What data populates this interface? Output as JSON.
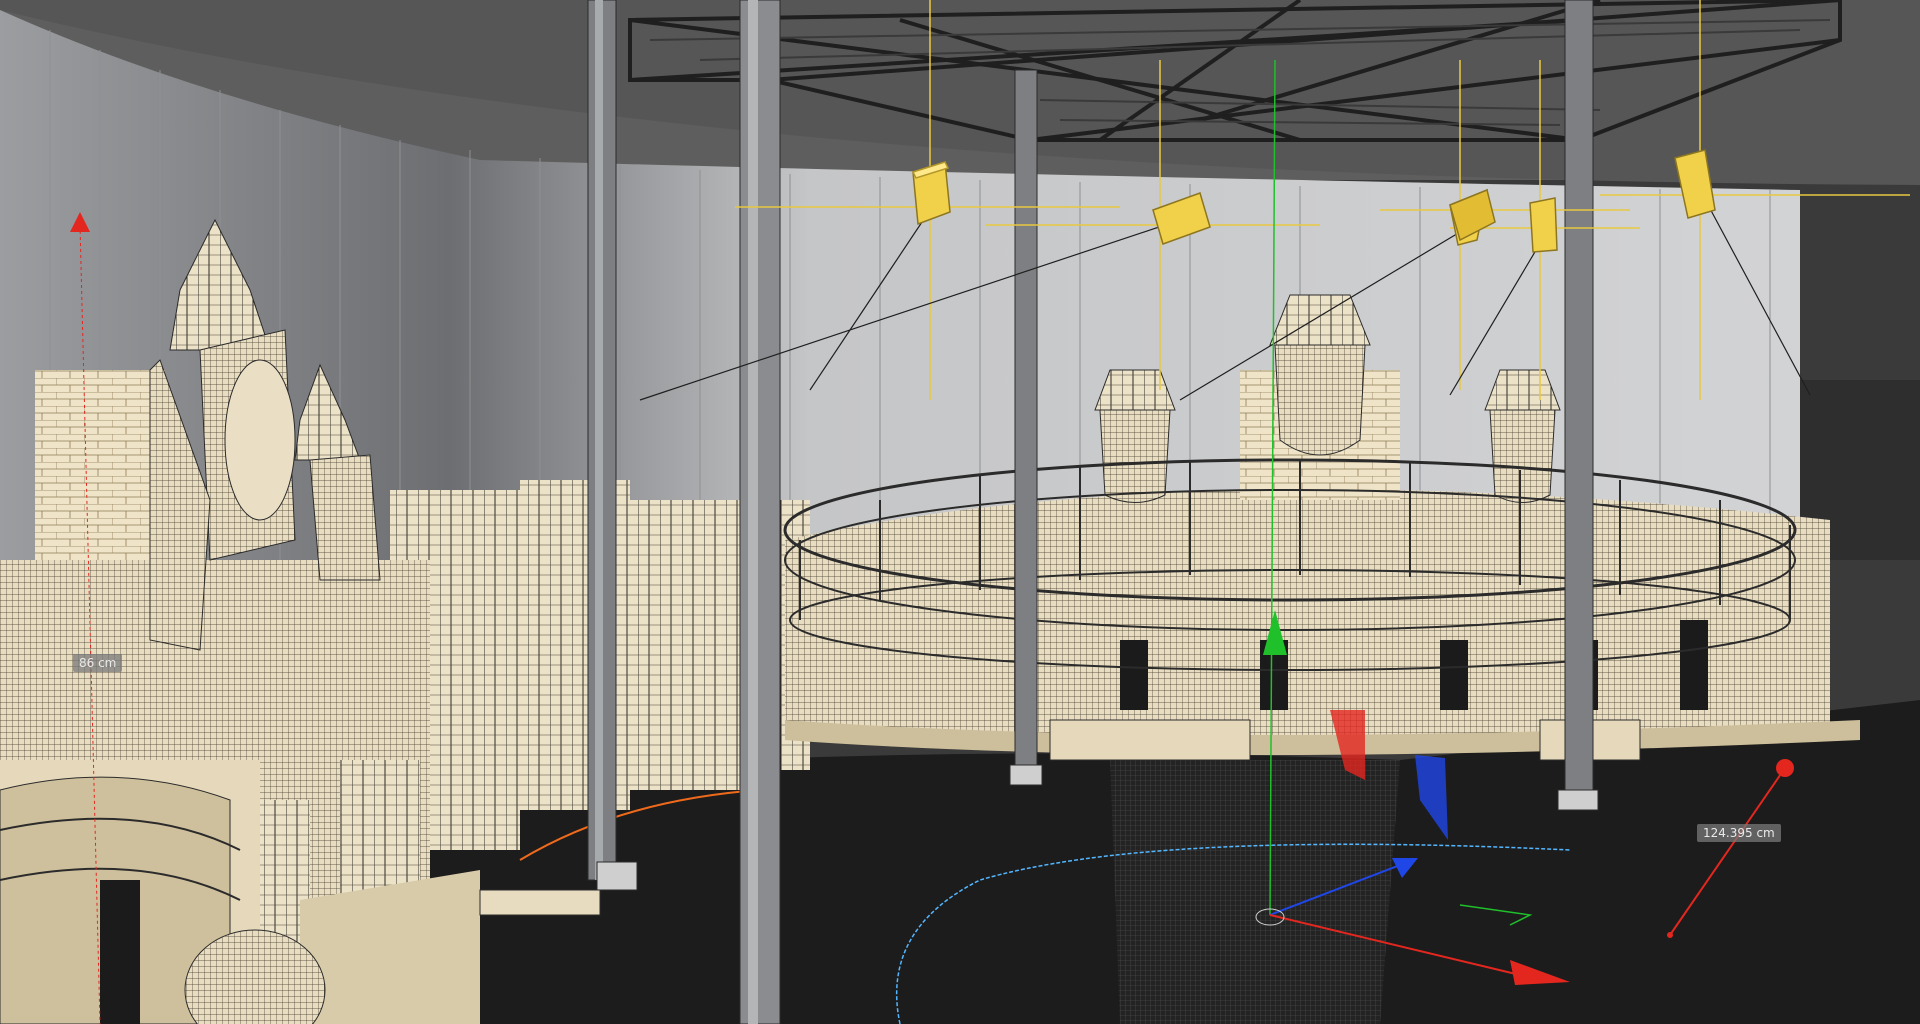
{
  "viewport": {
    "measurements": {
      "height_label": "86 cm",
      "distance_label": "124.395 cm"
    }
  },
  "colors": {
    "floor": "#1c1c1c",
    "wall_light": "#cfd0d2",
    "wall_dark": "#7f8184",
    "ceiling": "#5a5a5a",
    "stone": "#e8dcc0",
    "stone_shade": "#b9ab86",
    "wire": "#2b2b2b",
    "light_gizmo": "#f1d04a",
    "axis_x": "#e3271f",
    "axis_y": "#1fc02a",
    "axis_z": "#1f47e8",
    "selection_orange": "#f06a1c",
    "measure_blue": "#53b6ff"
  },
  "gizmos": {
    "lights": [
      "light-icon",
      "light-icon",
      "light-icon",
      "light-icon",
      "light-icon"
    ],
    "transform": "move-axis-gizmo"
  }
}
